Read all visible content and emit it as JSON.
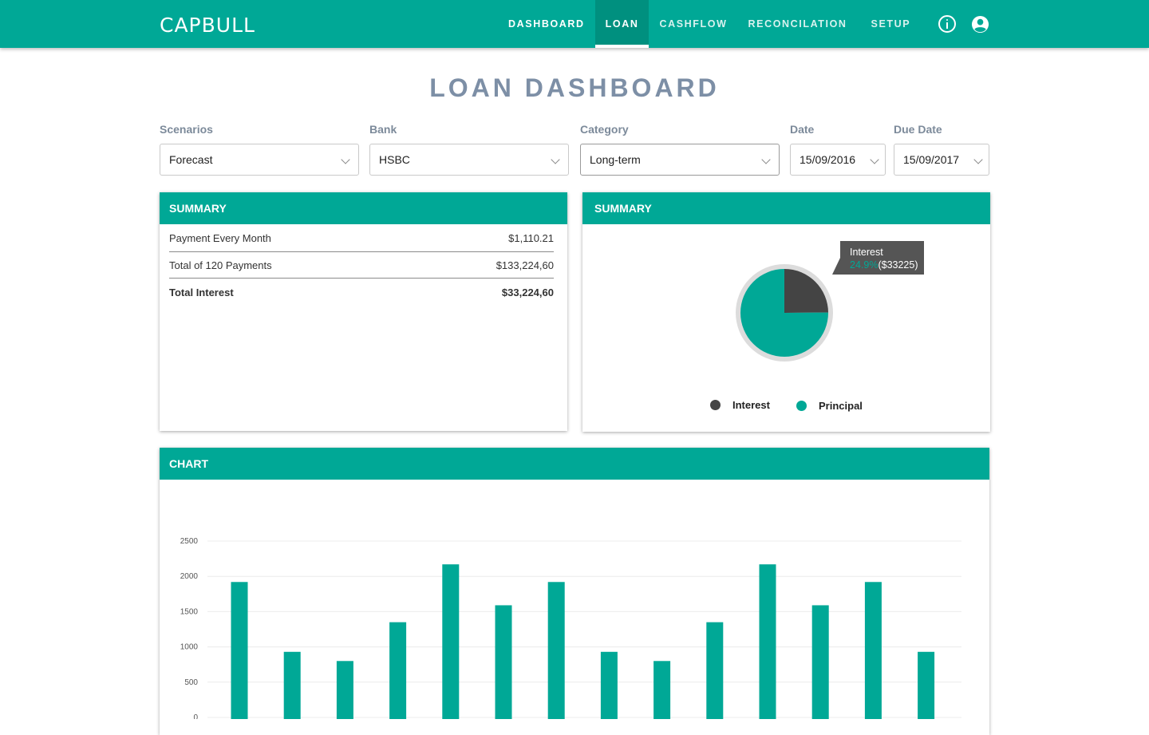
{
  "header": {
    "logo": "CAPBULL",
    "nav": [
      {
        "label": "DASHBOARD"
      },
      {
        "label": "LOAN"
      },
      {
        "label": "CASHFLOW"
      },
      {
        "label": "RECONCILATION"
      },
      {
        "label": "SETUP"
      }
    ],
    "active_nav": "LOAN",
    "icons": [
      "info-icon",
      "account-icon"
    ]
  },
  "page": {
    "title": "LOAN DASHBOARD"
  },
  "filters": {
    "scenarios": {
      "label": "Scenarios",
      "value": "Forecast"
    },
    "bank": {
      "label": "Bank",
      "value": "HSBC"
    },
    "category": {
      "label": "Category",
      "value": "Long-term"
    },
    "date": {
      "label": "Date",
      "value": "15/09/2016"
    },
    "due_date": {
      "label": "Due Date",
      "value": "15/09/2017"
    }
  },
  "summary_table": {
    "title": "SUMMARY",
    "rows": [
      {
        "label": "Payment Every Month",
        "value": "$1,110.21"
      },
      {
        "label": "Total of 120 Payments",
        "value": "$133,224,60"
      },
      {
        "label": "Total Interest",
        "value": "$33,224,60"
      }
    ]
  },
  "summary_pie": {
    "title": "SUMMARY",
    "tooltip": {
      "label": "Interest",
      "percent": "24.9%",
      "amount": "($33225)"
    },
    "legend": [
      {
        "name": "Interest",
        "color": "#444444"
      },
      {
        "name": "Principal",
        "color": "#00a896"
      }
    ]
  },
  "chart_section": {
    "title": "CHART"
  },
  "colors": {
    "accent": "#00a896",
    "title": "#7d8fa6",
    "interest": "#444444"
  },
  "chart_data": [
    {
      "type": "pie",
      "labels": [
        "Interest",
        "Principal"
      ],
      "values": [
        24.9,
        75.1
      ]
    },
    {
      "type": "bar",
      "values": [
        1920,
        930,
        800,
        1350,
        2170,
        1590,
        1920,
        930,
        800,
        1350,
        2170,
        1590,
        1920,
        930
      ],
      "yticks": [
        "2500",
        "2000",
        "1500",
        "1000",
        "500",
        "0"
      ],
      "ylim": [
        0,
        2500
      ],
      "grid": true,
      "color": "#00a896"
    }
  ]
}
